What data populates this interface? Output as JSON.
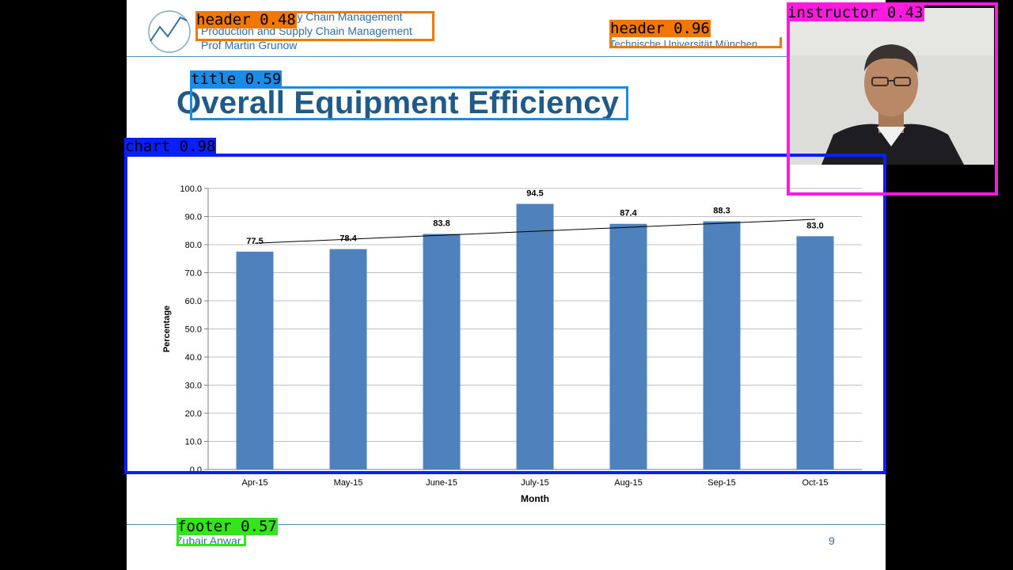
{
  "slide": {
    "header_lines": [
      "Logistics and Supply Chain Management",
      "Production and Supply Chain Management",
      "Prof Martin Grunow"
    ],
    "header_right": "Technische Universität München",
    "title": "Overall Equipment Efficiency",
    "footer_left": "Zubair Anwar",
    "page_number": "9"
  },
  "colors": {
    "bar": "#4f81bd",
    "heading": "#1f5a88",
    "accent_line": "#5b8ab5",
    "header_box": "#f07800",
    "title_box": "#1a8be6",
    "chart_box": "#0a1fff",
    "instructor_box": "#ff1ae0",
    "footer_box": "#33e619"
  },
  "detections": [
    {
      "label": "header",
      "score": "0.48"
    },
    {
      "label": "header",
      "score": "0.96"
    },
    {
      "label": "title",
      "score": "0.59"
    },
    {
      "label": "chart",
      "score": "0.98"
    },
    {
      "label": "instructor",
      "score": "0.43"
    },
    {
      "label": "footer",
      "score": "0.57"
    }
  ],
  "chart_data": {
    "type": "bar",
    "categories": [
      "Apr-15",
      "May-15",
      "June-15",
      "July-15",
      "Aug-15",
      "Sep-15",
      "Oct-15"
    ],
    "values": [
      77.5,
      78.4,
      83.8,
      94.5,
      87.4,
      88.3,
      83.0
    ],
    "value_labels": [
      "77.5",
      "78.4",
      "83.8",
      "94.5",
      "87.4",
      "88.3",
      "83.0"
    ],
    "yticks": [
      "0.0",
      "10.0",
      "20.0",
      "30.0",
      "40.0",
      "50.0",
      "60.0",
      "70.0",
      "80.0",
      "90.0",
      "100.0"
    ],
    "xlabel": "Month",
    "ylabel": "Percentage",
    "ylim": [
      0,
      100
    ],
    "grid": true,
    "trendline": {
      "type": "linear",
      "start": 80.5,
      "end": 89.0
    }
  }
}
